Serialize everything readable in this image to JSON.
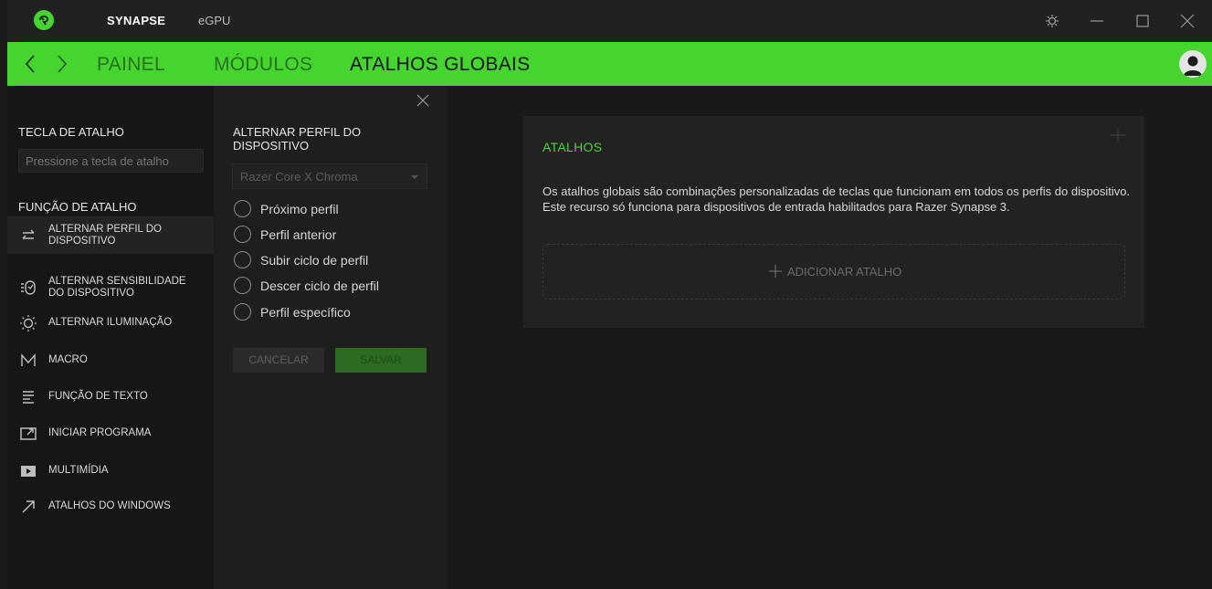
{
  "titlebar": {
    "app_name": "SYNAPSE",
    "device_tab": "eGPU"
  },
  "nav": {
    "tabs": [
      {
        "label": "PAINEL",
        "active": false
      },
      {
        "label": "MÓDULOS",
        "active": false
      },
      {
        "label": "ATALHOS GLOBAIS",
        "active": true
      }
    ]
  },
  "sidebar": {
    "hotkey_heading": "TECLA DE ATALHO",
    "hotkey_placeholder": "Pressione a tecla de atalho",
    "function_heading": "FUNÇÃO DE ATALHO",
    "items": [
      {
        "label": "ALTERNAR PERFIL DO\nDISPOSITIVO",
        "icon": "swap-icon",
        "active": true
      },
      {
        "label": "ALTERNAR SENSIBILIDADE\nDO DISPOSITIVO",
        "icon": "sensitivity-icon",
        "active": false
      },
      {
        "label": "ALTERNAR ILUMINAÇÃO",
        "icon": "lighting-icon",
        "active": false
      },
      {
        "label": "MACRO",
        "icon": "macro-icon",
        "active": false
      },
      {
        "label": "FUNÇÃO DE TEXTO",
        "icon": "text-icon",
        "active": false
      },
      {
        "label": "INICIAR PROGRAMA",
        "icon": "launch-icon",
        "active": false
      },
      {
        "label": "MULTIMÍDIA",
        "icon": "multimedia-icon",
        "active": false
      },
      {
        "label": "ATALHOS DO WINDOWS",
        "icon": "arrow-diagonal-icon",
        "active": false
      }
    ]
  },
  "panel": {
    "title": "ALTERNAR PERFIL DO DISPOSITIVO",
    "device_select": "Razer Core X Chroma",
    "options": [
      "Próximo perfil",
      "Perfil anterior",
      "Subir ciclo de perfil",
      "Descer ciclo de perfil",
      "Perfil específico"
    ],
    "cancel_label": "CANCELAR",
    "save_label": "SALVAR"
  },
  "main": {
    "card_title": "ATALHOS",
    "description": "Os atalhos globais são combinações personalizadas de teclas que funcionam em todos os perfis do dispositivo. Este recurso só funciona para dispositivos de entrada habilitados para Razer Synapse 3.",
    "add_label": "ADICIONAR ATALHO"
  },
  "colors": {
    "accent": "#44d62c",
    "background": "#1a1a1a"
  }
}
